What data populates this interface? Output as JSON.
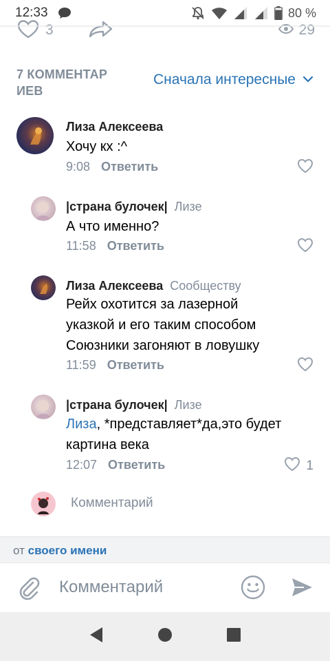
{
  "status_bar": {
    "time": "12:33",
    "battery_percent": "80 %"
  },
  "post_reactions": {
    "likes": "3",
    "views": "29"
  },
  "comments_header": {
    "count_label": "7 КОММЕНТАР ИЕВ",
    "sort_label": "Сначала интересные"
  },
  "comments": [
    {
      "author": "Лиза Алексеева",
      "reply_to": "",
      "text_lines": [
        "Хочу кх :^"
      ],
      "time": "9:08",
      "reply_label": "Ответить",
      "likes": ""
    },
    {
      "author": "|страна булочек|",
      "reply_to": "Лизе",
      "text_lines": [
        "А что именно?"
      ],
      "time": "11:58",
      "reply_label": "Ответить",
      "likes": ""
    },
    {
      "author": "Лиза Алексеева",
      "reply_to": "Сообществу",
      "text_lines": [
        "Рейх охотится за лазерной",
        "указкой и его таким способом",
        "Союзники загоняют в ловушку"
      ],
      "time": "11:59",
      "reply_label": "Ответить",
      "likes": ""
    },
    {
      "author": "|страна булочек|",
      "reply_to": "Лизе",
      "mention": "Лиза",
      "text_line1_rest": ", *представляет*да,это будет",
      "text_lines": [
        "картина века"
      ],
      "time": "12:07",
      "reply_label": "Ответить",
      "likes": "1"
    }
  ],
  "inline_composer": {
    "placeholder": "Комментарий"
  },
  "sender": {
    "prefix": "от",
    "name": "своего имени"
  },
  "composer": {
    "placeholder": "Комментарий"
  },
  "colors": {
    "accent": "#2a73b5",
    "secondary_text": "#818c99",
    "icon_gray": "#99a2ad"
  }
}
